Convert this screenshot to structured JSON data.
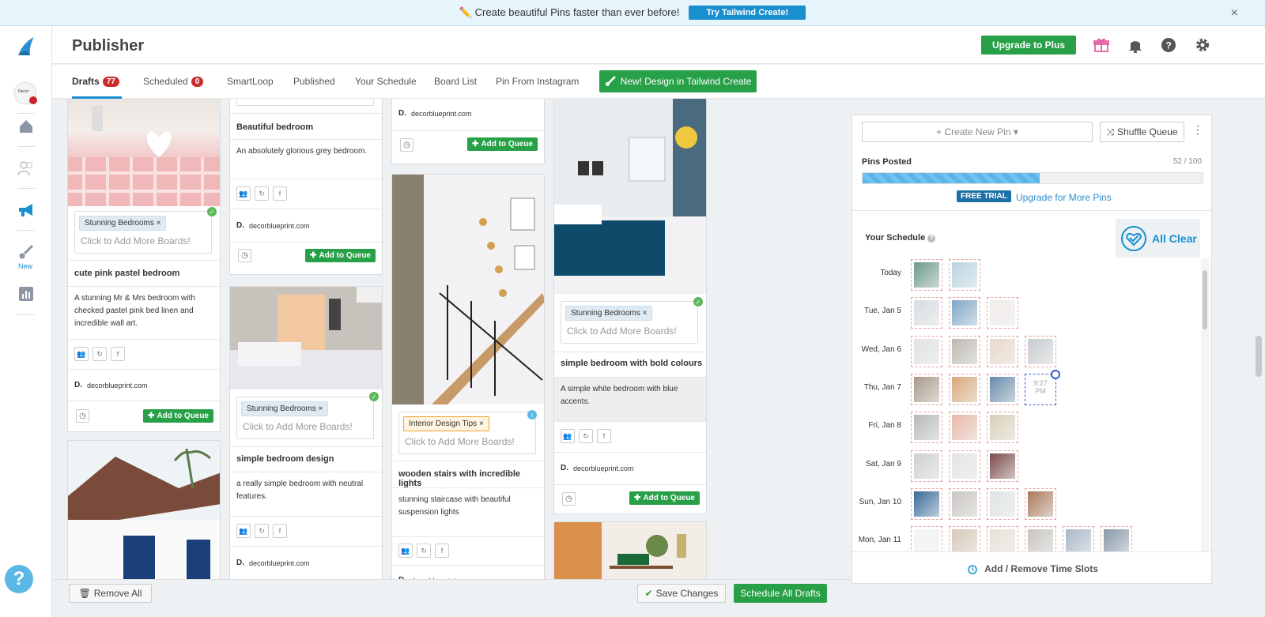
{
  "banner": {
    "text": "✏️ Create beautiful Pins faster than ever before!",
    "button": "Try Tailwind Create!",
    "close": "×"
  },
  "header": {
    "title": "Publisher",
    "upgrade": "Upgrade to Plus"
  },
  "sidebar": {
    "new_label": "New"
  },
  "tabs": {
    "drafts": "Drafts",
    "drafts_count": "77",
    "scheduled": "Scheduled",
    "scheduled_count": "0",
    "smartloop": "SmartLoop",
    "published": "Published",
    "your_schedule": "Your Schedule",
    "board_list": "Board List",
    "pin_from_instagram": "Pin From Instagram",
    "design_button": "New! Design in Tailwind Create"
  },
  "common": {
    "add_more": "Click to Add More Boards!",
    "add_to_queue": "Add to Queue",
    "domain": "decorblueprint.com",
    "domain_initial": "D.",
    "remove_tag": "×"
  },
  "pins": [
    {
      "board": "Stunning Bedrooms",
      "title": "cute pink pastel bedroom",
      "description": "A stunning Mr & Mrs bedroom with checked pastel pink bed linen and incredible wall art."
    },
    {
      "title": "Beautiful bedroom",
      "description": "An absolutely glorious grey bedroom."
    },
    {
      "board": "Stunning Bedrooms",
      "title": "simple bedroom design",
      "description": "a really simple bedroom with neutral features."
    },
    {
      "board": "Interior Design Tips",
      "title": "wooden stairs with incredible lights",
      "description": "stunning staircase with beautiful suspension lights"
    },
    {
      "board": "Stunning Bedrooms",
      "title": "simple bedroom with bold colours",
      "description": "A simple white bedroom with blue accents."
    }
  ],
  "bottom": {
    "remove_all": "Remove All",
    "save_changes": "Save Changes",
    "schedule_all": "Schedule All Drafts"
  },
  "panel": {
    "create_new": "+ Create New Pin ▾",
    "shuffle": "Shuffle Queue",
    "pins_posted_label": "Pins Posted",
    "pins_posted_count": "52 / 100",
    "pins_posted_fraction": 0.52,
    "free_trial": "FREE TRIAL",
    "upgrade_more": "Upgrade for More Pins",
    "your_schedule": "Your Schedule",
    "all_clear": "All Clear",
    "add_remove_slots": "Add / Remove Time Slots",
    "slot_time": "9:27",
    "slot_ampm": "PM"
  },
  "schedule": [
    {
      "day": "Today",
      "slots": [
        "#6b9a8a",
        "#b8d4e0"
      ]
    },
    {
      "day": "Tue, Jan 5",
      "slots": [
        "#d8dde2",
        "#7fa8c8",
        "#f0ecea"
      ]
    },
    {
      "day": "Wed, Jan 6",
      "slots": [
        "#e2e2e2",
        "#bcb8b0",
        "#e8d8c8",
        "#c8ccd0"
      ]
    },
    {
      "day": "Thu, Jan 7",
      "slots": [
        "#a89888",
        "#d8a878",
        "#6688aa",
        "empty"
      ]
    },
    {
      "day": "Fri, Jan 8",
      "slots": [
        "#b8b8b8",
        "#e8b8a8",
        "#d8d0b8"
      ]
    },
    {
      "day": "Sat, Jan 9",
      "slots": [
        "#d0d0d0",
        "#e4e4e4",
        "#7a4a48"
      ]
    },
    {
      "day": "Sun, Jan 10",
      "slots": [
        "#3a6a9a",
        "#c8c4c0",
        "#e0e4e4",
        "#a87a58"
      ]
    },
    {
      "day": "Mon, Jan 11",
      "slots": [
        "#f4f4f4",
        "#d8c8b8",
        "#e8e0d8",
        "#c8c4c0",
        "#a8b8c8",
        "#8898a8"
      ]
    }
  ]
}
